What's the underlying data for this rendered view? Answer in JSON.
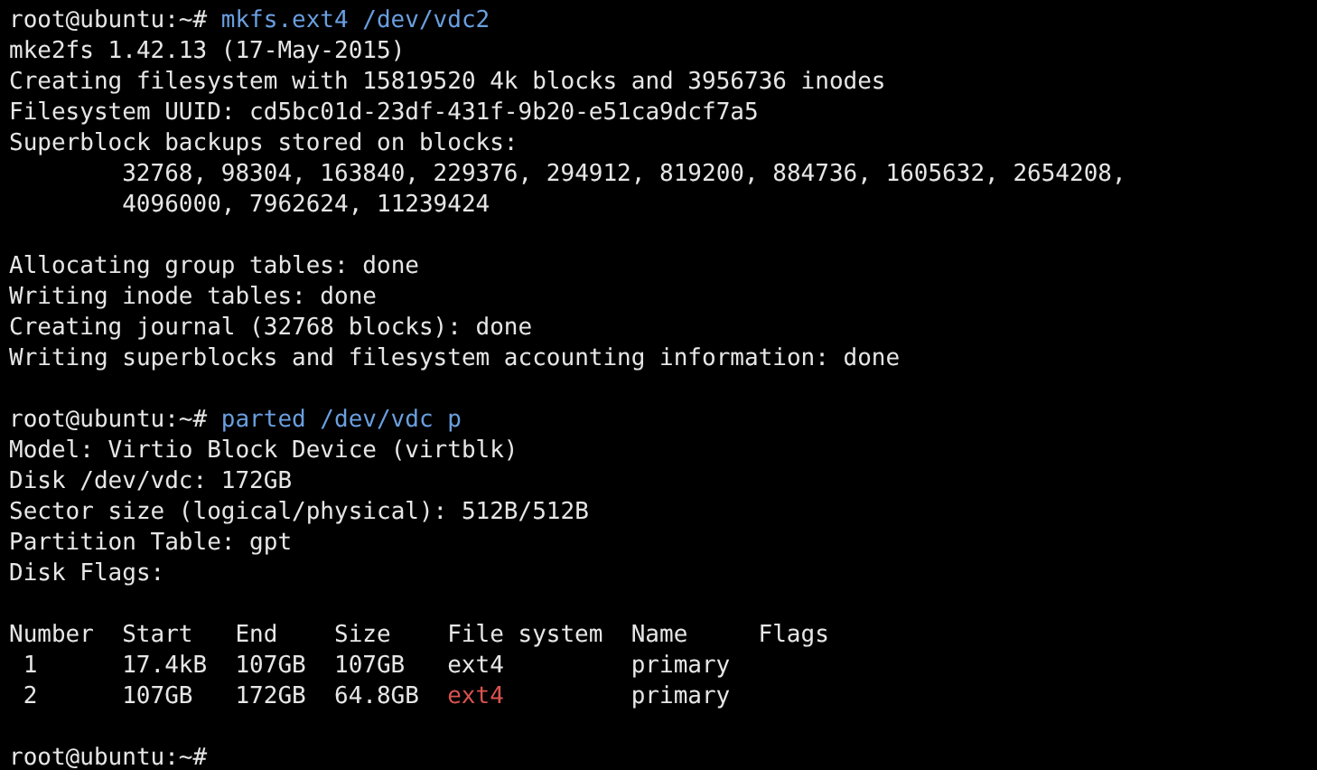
{
  "terminal": {
    "lines": [
      {
        "kind": "prompt",
        "prompt": "root@ubuntu:~#",
        "command": "mkfs.ext4 /dev/vdc2"
      },
      {
        "kind": "output",
        "text": "mke2fs 1.42.13 (17-May-2015)"
      },
      {
        "kind": "output",
        "text": "Creating filesystem with 15819520 4k blocks and 3956736 inodes"
      },
      {
        "kind": "output",
        "text": "Filesystem UUID: cd5bc01d-23df-431f-9b20-e51ca9dcf7a5"
      },
      {
        "kind": "output",
        "text": "Superblock backups stored on blocks:"
      },
      {
        "kind": "indented",
        "text": "32768, 98304, 163840, 229376, 294912, 819200, 884736, 1605632, 2654208,"
      },
      {
        "kind": "indented",
        "text": "4096000, 7962624, 11239424"
      },
      {
        "kind": "blank"
      },
      {
        "kind": "output",
        "text": "Allocating group tables: done"
      },
      {
        "kind": "output",
        "text": "Writing inode tables: done"
      },
      {
        "kind": "output",
        "text": "Creating journal (32768 blocks): done"
      },
      {
        "kind": "output",
        "text": "Writing superblocks and filesystem accounting information: done"
      },
      {
        "kind": "blank"
      },
      {
        "kind": "prompt",
        "prompt": "root@ubuntu:~#",
        "command": "parted /dev/vdc p"
      },
      {
        "kind": "output",
        "text": "Model: Virtio Block Device (virtblk)"
      },
      {
        "kind": "output",
        "text": "Disk /dev/vdc: 172GB"
      },
      {
        "kind": "output",
        "text": "Sector size (logical/physical): 512B/512B"
      },
      {
        "kind": "output",
        "text": "Partition Table: gpt"
      },
      {
        "kind": "output",
        "text": "Disk Flags:"
      },
      {
        "kind": "blank"
      },
      {
        "kind": "table",
        "columns": [
          "Number",
          "Start",
          "End",
          "Size",
          "File system",
          "Name",
          "Flags"
        ],
        "rows": [
          {
            "number": "1",
            "start": "17.4kB",
            "end": "107GB",
            "size": "107GB",
            "file_system": {
              "text": "ext4",
              "color": "#e6e6e6"
            },
            "name": "primary"
          },
          {
            "number": "2",
            "start": "107GB",
            "end": "172GB",
            "size": "64.8GB",
            "file_system": {
              "text": "ext4",
              "color": "#d9534f"
            },
            "name": "primary"
          }
        ]
      },
      {
        "kind": "blank"
      },
      {
        "kind": "prompt",
        "prompt": "root@ubuntu:~#"
      }
    ]
  }
}
